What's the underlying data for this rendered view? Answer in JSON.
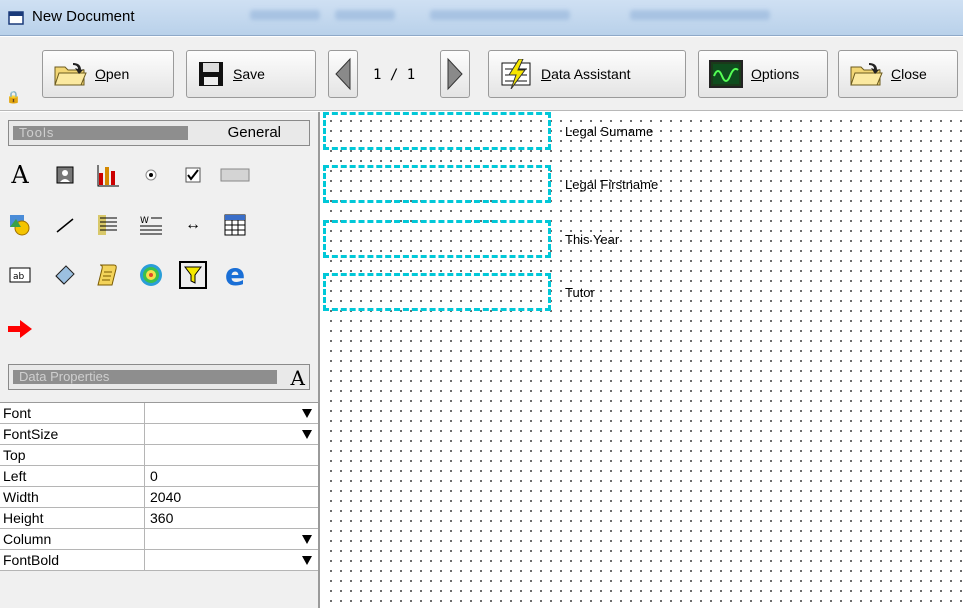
{
  "window": {
    "title": "New Document"
  },
  "toolbar": {
    "open_label": "Open",
    "save_label": "Save",
    "page_indicator": "1 / 1",
    "data_assistant_label": "Data Assistant",
    "options_label": "Options",
    "close_label": "Close"
  },
  "tools_panel": {
    "title": "Tools",
    "category": "General"
  },
  "data_properties": {
    "title": "Data Properties",
    "rows": [
      {
        "name": "Font",
        "value": "",
        "dropdown": true
      },
      {
        "name": "FontSize",
        "value": "",
        "dropdown": true
      },
      {
        "name": "Top",
        "value": "",
        "dropdown": false
      },
      {
        "name": "Left",
        "value": "0",
        "dropdown": false
      },
      {
        "name": "Width",
        "value": "2040",
        "dropdown": false
      },
      {
        "name": "Height",
        "value": "360",
        "dropdown": false
      },
      {
        "name": "Column",
        "value": "",
        "dropdown": true
      },
      {
        "name": "FontBold",
        "value": "",
        "dropdown": true
      }
    ]
  },
  "canvas": {
    "fields": [
      {
        "label": "Legal Surname"
      },
      {
        "label": "Legal Firstname"
      },
      {
        "label": "This Year"
      },
      {
        "label": "Tutor"
      }
    ]
  },
  "colors": {
    "field_border": "#00c8d8",
    "arrow": "#ff0000"
  }
}
